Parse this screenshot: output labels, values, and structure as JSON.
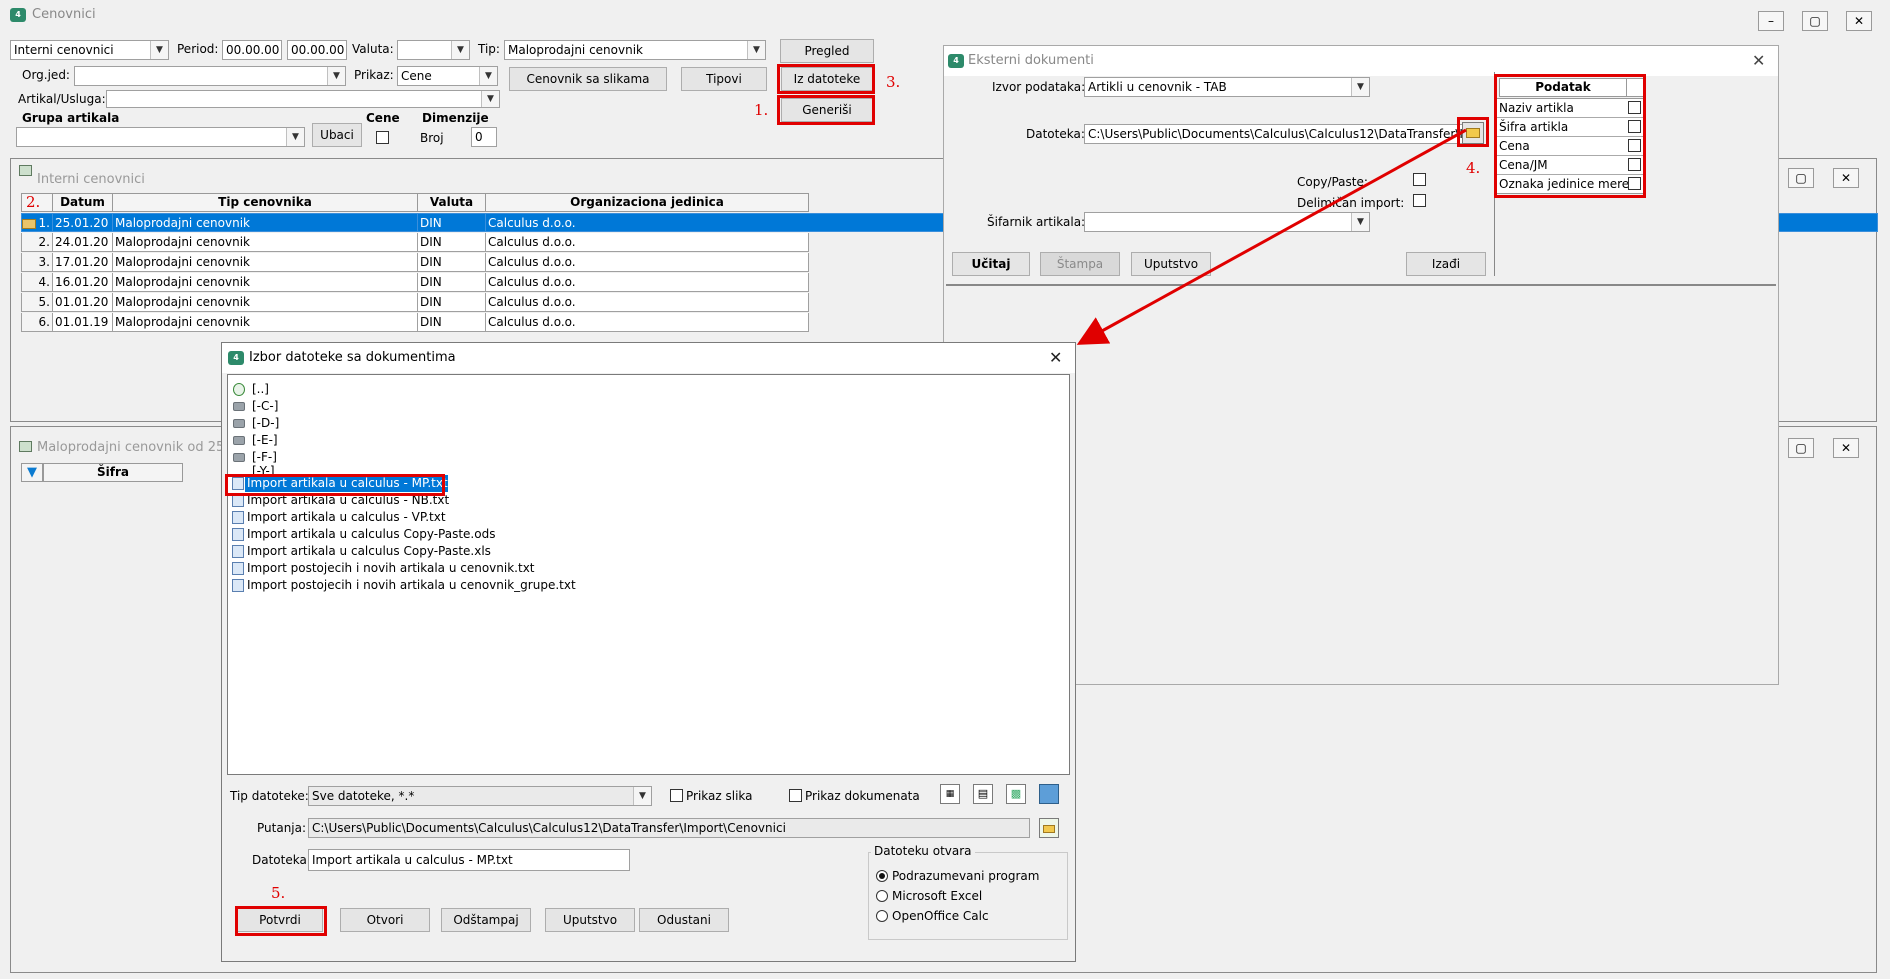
{
  "main": {
    "title": "Cenovnici",
    "toolbar": {
      "type_combo": "Interni cenovnici",
      "period_label": "Period:",
      "period_from": "00.00.00",
      "period_to": "00.00.00",
      "currency_label": "Valuta:",
      "currency_value": "",
      "tip_label": "Tip:",
      "tip_value": "Maloprodajni cenovnik",
      "pregled": "Pregled",
      "orgjed_label": "Org.jed:",
      "prikaz_label": "Prikaz:",
      "prikaz_value": "Cene",
      "cenovnik_slike": "Cenovnik sa slikama",
      "tipovi": "Tipovi",
      "iz_datoteke": "Iz datoteke",
      "artikal_label": "Artikal/Usluga:",
      "generisi": "Generiši",
      "grupa_label": "Grupa artikala",
      "ubaci": "Ubaci",
      "cene_label": "Cene",
      "dimenzije_label": "Dimenzije",
      "broj_label": "Broj",
      "broj_value": "0"
    },
    "annotations": [
      "1.",
      "2.",
      "3.",
      "4.",
      "5."
    ]
  },
  "interni": {
    "title": "Interni cenovnici",
    "columns": [
      "Datum",
      "Tip cenovnika",
      "Valuta",
      "Organizaciona jedinica"
    ],
    "rows": [
      {
        "num": "1.",
        "datum": "25.01.20",
        "tip": "Maloprodajni cenovnik",
        "valuta": "DIN",
        "org": "Calculus d.o.o."
      },
      {
        "num": "2.",
        "datum": "24.01.20",
        "tip": "Maloprodajni cenovnik",
        "valuta": "DIN",
        "org": "Calculus d.o.o."
      },
      {
        "num": "3.",
        "datum": "17.01.20",
        "tip": "Maloprodajni cenovnik",
        "valuta": "DIN",
        "org": "Calculus d.o.o."
      },
      {
        "num": "4.",
        "datum": "16.01.20",
        "tip": "Maloprodajni cenovnik",
        "valuta": "DIN",
        "org": "Calculus d.o.o."
      },
      {
        "num": "5.",
        "datum": "01.01.20",
        "tip": "Maloprodajni cenovnik",
        "valuta": "DIN",
        "org": "Calculus d.o.o."
      },
      {
        "num": "6.",
        "datum": "01.01.19",
        "tip": "Maloprodajni cenovnik",
        "valuta": "DIN",
        "org": "Calculus d.o.o."
      }
    ]
  },
  "malo": {
    "title": "Maloprodajni cenovnik od 25",
    "sifra_col": "Šifra"
  },
  "eksterni": {
    "title": "Eksterni dokumenti",
    "izvor_label": "Izvor podataka:",
    "izvor_value": "Artikli u cenovnik - TAB",
    "datoteka_label": "Datoteka:",
    "datoteka_value": "C:\\Users\\Public\\Documents\\Calculus\\Calculus12\\DataTransfer\\Import",
    "copy_paste_label": "Copy/Paste:",
    "delimican_label": "Delimičan import:",
    "sifarnik_label": "Šifarnik artikala:",
    "ucitaj": "Učitaj",
    "stampa": "Štampa",
    "uputstvo": "Uputstvo",
    "izadji": "Izađi",
    "podatak_header": "Podatak",
    "podatak_items": [
      "Naziv artikla",
      "Šifra artikla",
      "Cena",
      "Cena/JM",
      "Oznaka jedinice mere"
    ]
  },
  "izbor": {
    "title": "Izbor datoteke sa dokumentima",
    "drives": [
      "[..]",
      "[-C-]",
      "[-D-]",
      "[-E-]",
      "[-F-]",
      "[-Y-]"
    ],
    "files": [
      "Import artikala u calculus - MP.txt",
      "Import artikala u calculus - NB.txt",
      "Import artikala u calculus - VP.txt",
      "Import artikala u calculus Copy-Paste.ods",
      "Import artikala u calculus Copy-Paste.xls",
      "Import postojecih i novih artikala u cenovnik.txt",
      "Import postojecih i novih artikala u cenovnik_grupe.txt"
    ],
    "tip_label": "Tip datoteke:",
    "tip_value": "Sve datoteke, *.*",
    "prikaz_slika": "Prikaz slika",
    "prikaz_dokumenata": "Prikaz dokumenata",
    "putanja_label": "Putanja:",
    "putanja_value": "C:\\Users\\Public\\Documents\\Calculus\\Calculus12\\DataTransfer\\Import\\Cenovnici",
    "datoteka_label": "Datoteka:",
    "datoteka_value": "Import artikala u calculus - MP.txt",
    "otvara_label": "Datoteku otvara",
    "open_options": [
      "Podrazumevani program",
      "Microsoft Excel",
      "OpenOffice Calc"
    ],
    "potvrdi": "Potvrdi",
    "otvori": "Otvori",
    "odstampaj": "Odštampaj",
    "uputstvo": "Uputstvo",
    "odustani": "Odustani"
  }
}
